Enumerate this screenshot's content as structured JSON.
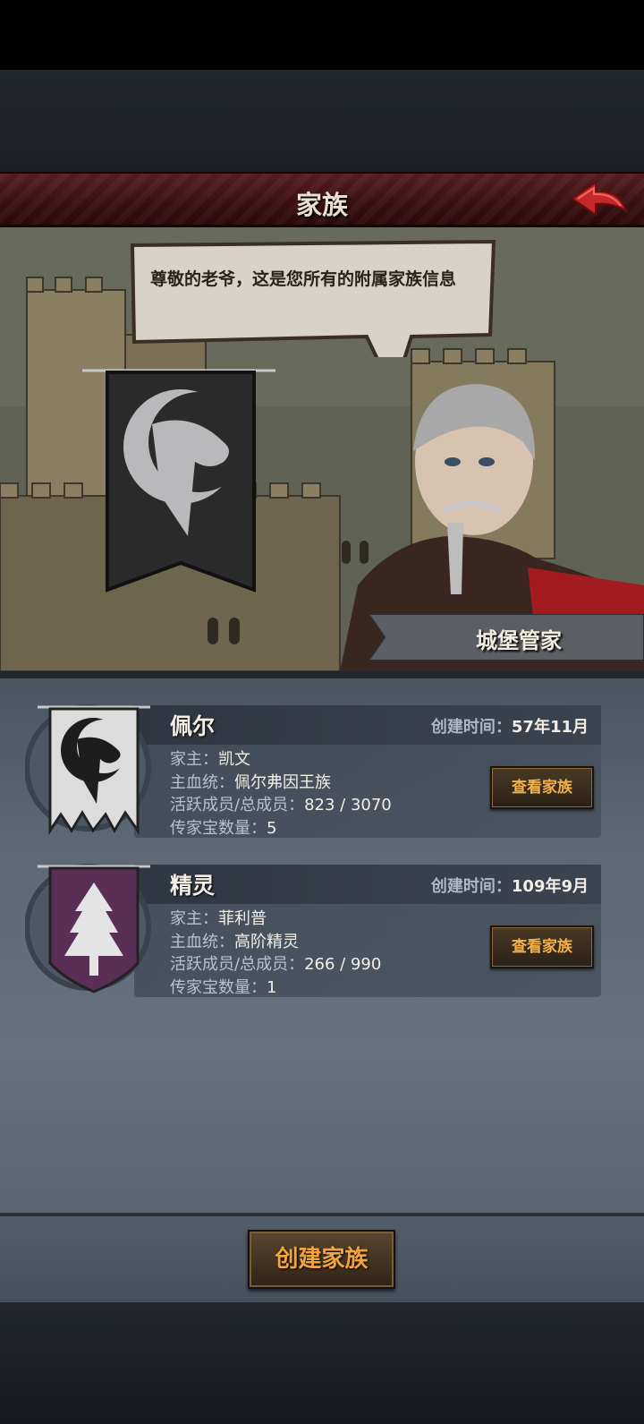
{
  "header": {
    "title": "家族"
  },
  "scene": {
    "speech": "尊敬的老爷，这是您所有的附属家族信息",
    "npc_name": "城堡管家"
  },
  "families": [
    {
      "name": "佩尔",
      "created_label": "创建时间：",
      "created_value": "57年11月",
      "head_label": "家主：",
      "head_value": "凯文",
      "bloodline_label": "主血统：",
      "bloodline_value": "佩尔弗因王族",
      "members_label": "活跃成员/总成员：",
      "members_value": "823 / 3070",
      "heirloom_label": "传家宝数量：",
      "heirloom_value": "5",
      "button": "查看家族",
      "banner_color": "#dcdcdc",
      "emblem_icon": "crescent-serpent-icon"
    },
    {
      "name": "精灵",
      "created_label": "创建时间：",
      "created_value": "109年9月",
      "head_label": "家主：",
      "head_value": "菲利普",
      "bloodline_label": "主血统：",
      "bloodline_value": "高阶精灵",
      "members_label": "活跃成员/总成员：",
      "members_value": "266 / 990",
      "heirloom_label": "传家宝数量：",
      "heirloom_value": "1",
      "button": "查看家族",
      "banner_color": "#5a2f55",
      "emblem_icon": "pine-tree-icon"
    }
  ],
  "footer": {
    "create_button": "创建家族"
  },
  "colors": {
    "header": "#4a1517",
    "accent_button_text": "#f2b04a",
    "back_arrow": "#c4282a"
  }
}
